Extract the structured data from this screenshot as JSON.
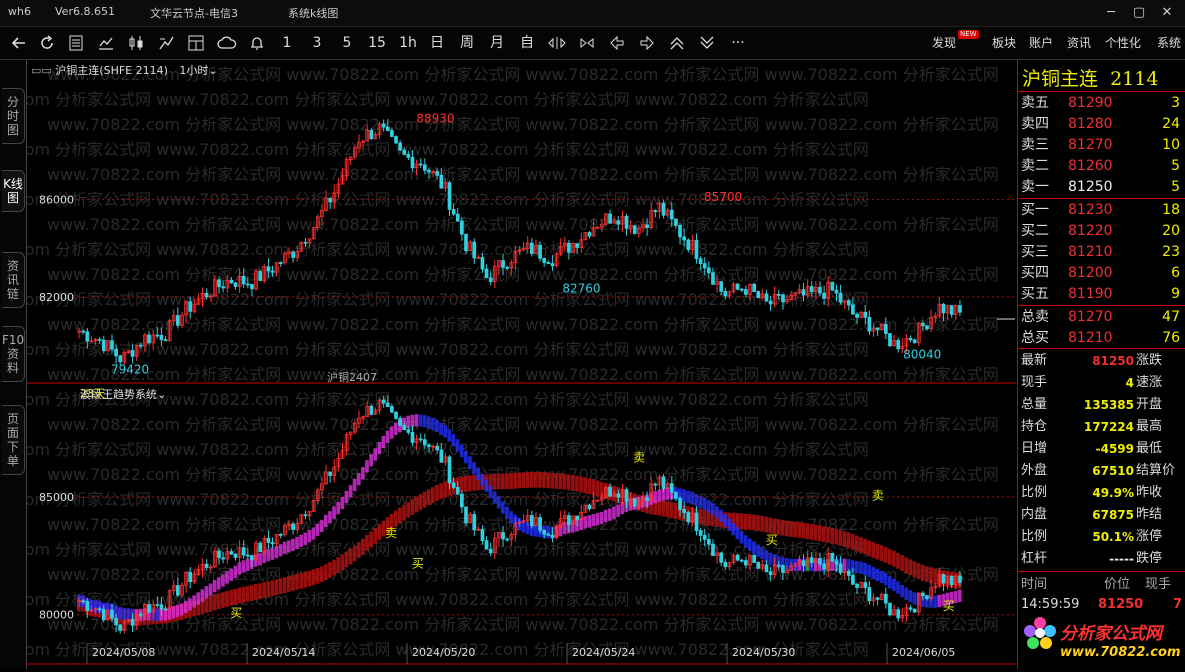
{
  "window": {
    "app_name": "wh6",
    "version": "Ver6.8.651",
    "server": "文华云节点-电信3",
    "scheme": "系统k线图",
    "controls": [
      "─",
      "▢",
      "✕"
    ]
  },
  "toolbar": {
    "icons": [
      "back-arrow",
      "refresh",
      "list",
      "line-chart",
      "candlestick",
      "bar-chart",
      "layout",
      "cloud",
      "bell"
    ],
    "periods": [
      "1",
      "3",
      "5",
      "15",
      "1h",
      "日",
      "周",
      "月",
      "自"
    ],
    "nav_icons": [
      "expand-horizontal",
      "shrink-horizontal",
      "left",
      "right",
      "up",
      "down",
      "more"
    ],
    "right_items": {
      "discover": "发现",
      "new_badge": "NEW",
      "sector": "板块",
      "account": "账户",
      "news": "资讯",
      "personalize": "个性化",
      "system": "系统"
    }
  },
  "sidebar": {
    "tabs": [
      "分时图",
      "K线图",
      "资讯链",
      "F10资料",
      "页面下单"
    ],
    "active": 1
  },
  "chart_header": {
    "symbol": "沪铜主连(SHFE 2114)",
    "period": "1小时",
    "period_arrow": "⌄"
  },
  "watermark": "www.70822.com 分析家公式网",
  "chart_data": [
    {
      "type": "candlestick",
      "title": "沪铜主连",
      "ylim": [
        78500,
        91000
      ],
      "y_ticks": [
        86000,
        82000
      ],
      "price_labels": [
        {
          "text": "88930",
          "value": 88930,
          "color": "#ff3030"
        },
        {
          "text": "85700",
          "value": 85700,
          "color": "#ff3030"
        },
        {
          "text": "82760",
          "value": 82760,
          "color": "#30d0e0"
        },
        {
          "text": "80040",
          "value": 80040,
          "color": "#30d0e0"
        },
        {
          "text": "79420",
          "value": 79420,
          "color": "#30d0e0"
        }
      ],
      "footer_labels": {
        "days": "23天",
        "contract": "沪铜2407"
      },
      "close_path": [
        80600,
        80200,
        79420,
        80300,
        80500,
        81500,
        82200,
        82700,
        82600,
        83200,
        83900,
        85000,
        86500,
        88500,
        88930,
        87800,
        87500,
        86500,
        84200,
        82760,
        83600,
        84000,
        83600,
        84200,
        85000,
        85400,
        84800,
        85700,
        84600,
        83600,
        82100,
        82400,
        81700,
        81900,
        82100,
        82300,
        81300,
        80800,
        80040,
        80500,
        81600,
        81300
      ]
    },
    {
      "type": "indicator",
      "title": "波段王趋势系统",
      "title_arrow": "⌄",
      "ylim": [
        78800,
        89200
      ],
      "y_ticks": [
        85000,
        80000
      ],
      "x_ticks": [
        "2024/05/08",
        "2024/05/14",
        "2024/05/20",
        "2024/05/24",
        "2024/05/30",
        "2024/06/05"
      ],
      "signals": [
        {
          "label": "买",
          "at": 0.18,
          "value": 79900
        },
        {
          "label": "卖",
          "at": 0.355,
          "value": 83300
        },
        {
          "label": "买",
          "at": 0.385,
          "value": 82000
        },
        {
          "label": "卖",
          "at": 0.635,
          "value": 86500
        },
        {
          "label": "买",
          "at": 0.785,
          "value": 83000
        },
        {
          "label": "卖",
          "at": 0.905,
          "value": 84900
        },
        {
          "label": "买",
          "at": 0.985,
          "value": 80200
        }
      ]
    }
  ],
  "quote": {
    "name": "沪铜主连",
    "code": "2114",
    "asks": [
      {
        "label": "卖五",
        "price": "81290",
        "vol": "3"
      },
      {
        "label": "卖四",
        "price": "81280",
        "vol": "24"
      },
      {
        "label": "卖三",
        "price": "81270",
        "vol": "10"
      },
      {
        "label": "卖二",
        "price": "81260",
        "vol": "5"
      },
      {
        "label": "卖一",
        "price": "81250",
        "vol": "5"
      }
    ],
    "bids": [
      {
        "label": "买一",
        "price": "81230",
        "vol": "18"
      },
      {
        "label": "买二",
        "price": "81220",
        "vol": "20"
      },
      {
        "label": "买三",
        "price": "81210",
        "vol": "23"
      },
      {
        "label": "买四",
        "price": "81200",
        "vol": "6"
      },
      {
        "label": "买五",
        "price": "81190",
        "vol": "9"
      }
    ],
    "totals": [
      {
        "label": "总卖",
        "price": "81270",
        "vol": "47"
      },
      {
        "label": "总买",
        "price": "81210",
        "vol": "76"
      }
    ],
    "stats": [
      {
        "label": "最新",
        "value": "81250",
        "color": "red",
        "label2": "涨跌"
      },
      {
        "label": "现手",
        "value": "4",
        "color": "yel",
        "label2": "速涨"
      },
      {
        "label": "总量",
        "value": "135385",
        "color": "yel",
        "label2": "开盘"
      },
      {
        "label": "持仓",
        "value": "177224",
        "color": "yel",
        "label2": "最高"
      },
      {
        "label": "日增",
        "value": "-4599",
        "color": "yel",
        "label2": "最低"
      },
      {
        "label": "外盘",
        "value": "67510",
        "color": "yel",
        "label2": "结算价"
      },
      {
        "label": "比例",
        "value": "49.9%",
        "color": "yel",
        "label2": "昨收"
      },
      {
        "label": "内盘",
        "value": "67875",
        "color": "yel",
        "label2": "昨结"
      },
      {
        "label": "比例",
        "value": "50.1%",
        "color": "yel",
        "label2": "涨停"
      },
      {
        "label": "杠杆",
        "value": "-----",
        "color": "wht",
        "label2": "跌停"
      }
    ],
    "ticks_header": {
      "time": "时间",
      "price": "价位",
      "qty": "现手"
    },
    "ticks": [
      {
        "time": "14:59:59",
        "price": "81250",
        "qty": "7"
      }
    ],
    "logo_text": "分析家公式网",
    "logo_url": "www.70822.com"
  },
  "colors": {
    "up": "#ff3030",
    "down": "#30d0e0",
    "grid_red": "#a01010",
    "band_blue": "#2030ff",
    "band_magenta": "#e030e0",
    "band_green": "#30b030",
    "band_darkred": "#b01010"
  }
}
